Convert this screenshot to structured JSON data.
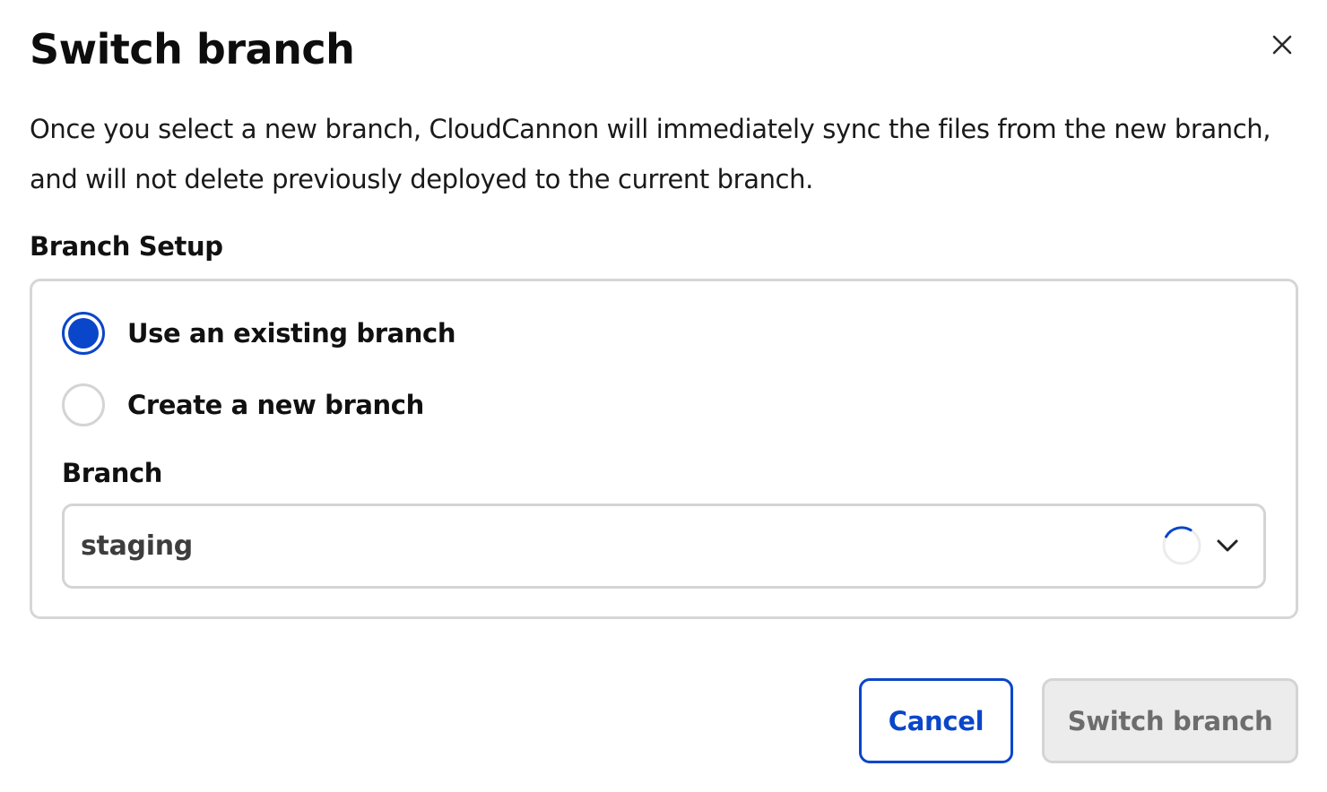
{
  "dialog": {
    "title": "Switch branch",
    "description": "Once you select a new branch, CloudCannon will immediately sync the files from the new branch, and will not delete previously deployed to the current branch."
  },
  "branch_setup": {
    "label": "Branch Setup",
    "options": [
      {
        "label": "Use an existing branch",
        "selected": true
      },
      {
        "label": "Create a new branch",
        "selected": false
      }
    ],
    "field_label": "Branch",
    "selected_branch": "staging",
    "loading": true
  },
  "actions": {
    "cancel_label": "Cancel",
    "submit_label": "Switch branch",
    "submit_disabled": true
  },
  "colors": {
    "accent": "#0a46c9",
    "border": "#d4d4d4",
    "disabled_bg": "#ececec",
    "disabled_text": "#6d6d6d"
  },
  "icons": {
    "close": "close-icon",
    "spinner": "spinner-icon",
    "chevron": "chevron-down-icon"
  }
}
